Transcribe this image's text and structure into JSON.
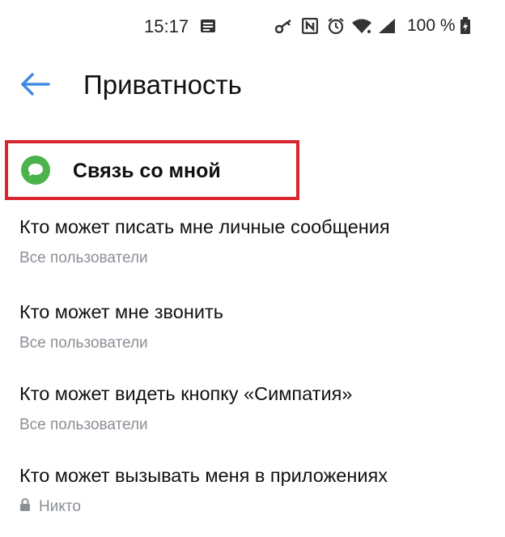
{
  "status_bar": {
    "time": "15:17",
    "battery": "100 %",
    "icons": [
      "notification-icon",
      "key-icon",
      "nfc-icon",
      "alarm-icon",
      "wifi-icon",
      "signal-icon",
      "battery-icon"
    ]
  },
  "header": {
    "title": "Приватность",
    "back_icon": "back-arrow-icon"
  },
  "section": {
    "label": "Связь со мной",
    "icon": "message-bubble-icon",
    "icon_color": "#4bb34b",
    "highlight_color": "#d9252f"
  },
  "items": [
    {
      "title": "Кто может писать мне личные сообщения",
      "value": "Все пользователи"
    },
    {
      "title": "Кто может мне звонить",
      "value": "Все пользователи"
    },
    {
      "title": "Кто может видеть кнопку «Симпатия»",
      "value": "Все пользователи"
    },
    {
      "title": "Кто может вызывать меня в приложениях",
      "value": "Никто",
      "icon": "lock-icon"
    }
  ],
  "colors": {
    "accent": "#3f8ae0",
    "secondary_text": "#8a8f96"
  }
}
